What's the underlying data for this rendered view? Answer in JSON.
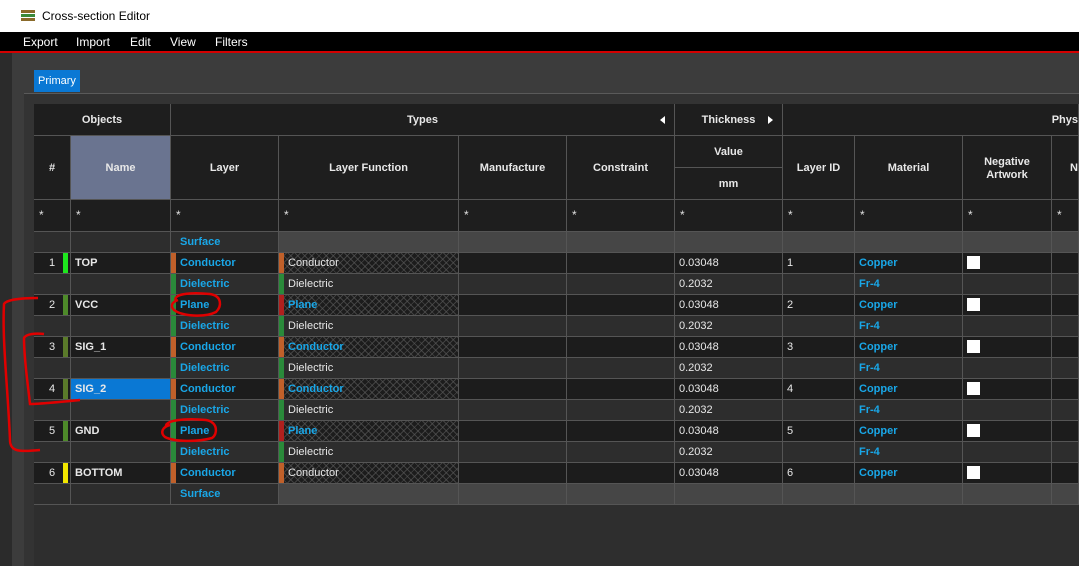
{
  "window": {
    "title": "Cross-section Editor"
  },
  "menu": [
    "Export",
    "Import",
    "Edit",
    "View",
    "Filters"
  ],
  "tabs": {
    "primary": "Primary"
  },
  "groups": {
    "objects": "Objects",
    "types": "Types",
    "thickness": "Thickness",
    "physical": "Phys"
  },
  "columns": {
    "num": "#",
    "name": "Name",
    "layer": "Layer",
    "layer_function": "Layer Function",
    "manufacture": "Manufacture",
    "constraint": "Constraint",
    "value": "Value",
    "unit": "mm",
    "layer_id": "Layer ID",
    "material": "Material",
    "negative_artwork": "Negative Artwork",
    "next": "N"
  },
  "filter_char": "*",
  "rows": [
    {
      "num": "",
      "name": "",
      "layer": "Surface",
      "func": "",
      "thick": "",
      "id": "",
      "mat": "",
      "chk": false,
      "kind": "surface"
    },
    {
      "num": "1",
      "name": "TOP",
      "layer": "Conductor",
      "func": "Conductor",
      "thick": "0.03048",
      "id": "1",
      "mat": "Copper",
      "chk": true,
      "kind": "cond",
      "chip": "#1ee61e",
      "func_cyan": false
    },
    {
      "num": "",
      "name": "",
      "layer": "Dielectric",
      "func": "Dielectric",
      "thick": "0.2032",
      "id": "",
      "mat": "Fr-4",
      "chk": false,
      "kind": "diel"
    },
    {
      "num": "2",
      "name": "VCC",
      "layer": "Plane",
      "func": "Plane",
      "thick": "0.03048",
      "id": "2",
      "mat": "Copper",
      "chk": true,
      "kind": "plane",
      "chip": "#4e8a2a",
      "func_cyan": true
    },
    {
      "num": "",
      "name": "",
      "layer": "Dielectric",
      "func": "Dielectric",
      "thick": "0.2032",
      "id": "",
      "mat": "Fr-4",
      "chk": false,
      "kind": "diel"
    },
    {
      "num": "3",
      "name": "SIG_1",
      "layer": "Conductor",
      "func": "Conductor",
      "thick": "0.03048",
      "id": "3",
      "mat": "Copper",
      "chk": true,
      "kind": "cond",
      "chip": "#5a7a2a",
      "func_cyan": true
    },
    {
      "num": "",
      "name": "",
      "layer": "Dielectric",
      "func": "Dielectric",
      "thick": "0.2032",
      "id": "",
      "mat": "Fr-4",
      "chk": false,
      "kind": "diel"
    },
    {
      "num": "4",
      "name": "SIG_2",
      "layer": "Conductor",
      "func": "Conductor",
      "thick": "0.03048",
      "id": "4",
      "mat": "Copper",
      "chk": true,
      "kind": "cond",
      "chip": "#5a7a2a",
      "func_cyan": true,
      "selected": true
    },
    {
      "num": "",
      "name": "",
      "layer": "Dielectric",
      "func": "Dielectric",
      "thick": "0.2032",
      "id": "",
      "mat": "Fr-4",
      "chk": false,
      "kind": "diel"
    },
    {
      "num": "5",
      "name": "GND",
      "layer": "Plane",
      "func": "Plane",
      "thick": "0.03048",
      "id": "5",
      "mat": "Copper",
      "chk": true,
      "kind": "plane",
      "chip": "#4e8a2a",
      "func_cyan": true
    },
    {
      "num": "",
      "name": "",
      "layer": "Dielectric",
      "func": "Dielectric",
      "thick": "0.2032",
      "id": "",
      "mat": "Fr-4",
      "chk": false,
      "kind": "diel"
    },
    {
      "num": "6",
      "name": "BOTTOM",
      "layer": "Conductor",
      "func": "Conductor",
      "thick": "0.03048",
      "id": "6",
      "mat": "Copper",
      "chk": true,
      "kind": "cond",
      "chip": "#f2e600",
      "func_cyan": false
    },
    {
      "num": "",
      "name": "",
      "layer": "Surface",
      "func": "",
      "thick": "",
      "id": "",
      "mat": "",
      "chk": false,
      "kind": "surface"
    }
  ],
  "colors": {
    "accent": "#0a78d4",
    "cyan_text": "#19a7e8",
    "conductor_stripe": "#c0602a",
    "dielectric_stripe": "#2a8a3a",
    "plane_stripe": "#b0201e",
    "annotation": "#e00000"
  }
}
